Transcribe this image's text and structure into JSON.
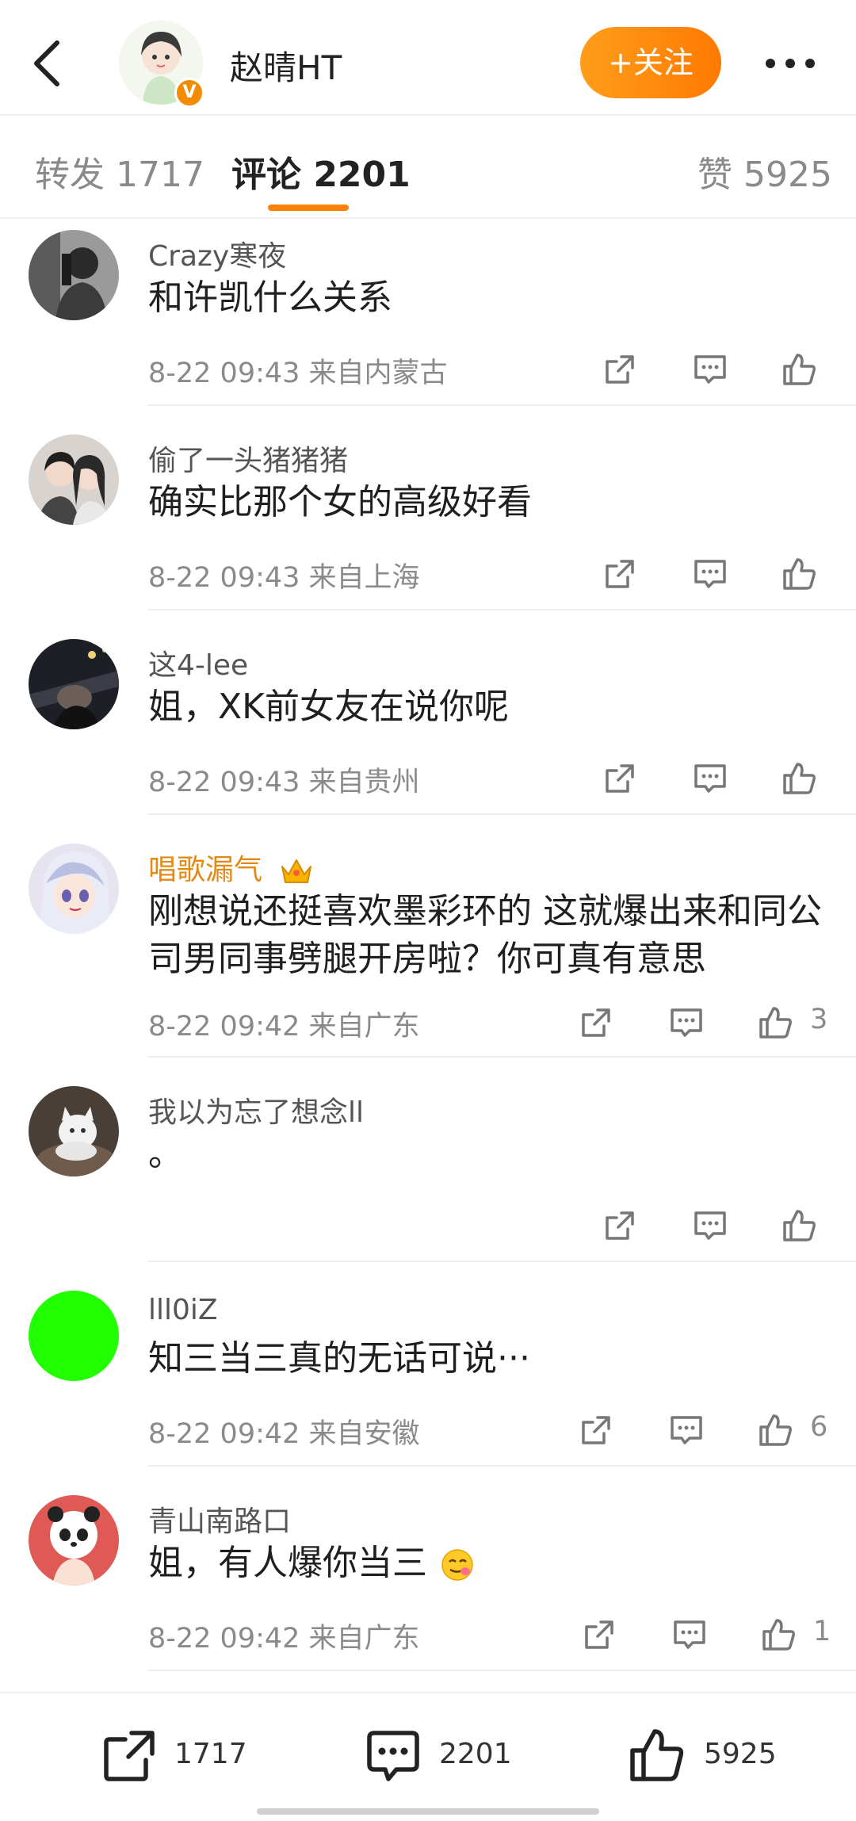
{
  "header": {
    "back_icon": "chevron-left-icon",
    "name": "赵晴HT",
    "verified_badge": "V",
    "follow_label": "+关注",
    "more_icon": "more-dots-icon",
    "accent_color": "#ff8200"
  },
  "tabs": [
    {
      "label": "转发 1717"
    },
    {
      "label": "评论 2201"
    },
    {
      "label": "赞 5925"
    }
  ],
  "comments": [
    {
      "user": "Crazy寒夜",
      "text": "和许凯什么关系",
      "meta": "8-22 09:43 来自内蒙古",
      "likes": ""
    },
    {
      "user": "偷了一头猪猪猪",
      "text": "确实比那个女的高级好看",
      "meta": "8-22 09:43 来自上海",
      "likes": ""
    },
    {
      "user": "这4-lee",
      "text": "姐，XK前女友在说你呢",
      "meta": "8-22 09:43 来自贵州",
      "likes": ""
    },
    {
      "user": "唱歌漏气",
      "text": "刚想说还挺喜欢墨彩环的 这就爆出来和同公司男同事劈腿开房啦？你可真有意思",
      "meta": "8-22 09:42 来自广东",
      "likes": "3"
    },
    {
      "user": "我以为忘了想念ll",
      "text": "。",
      "meta": "",
      "likes": ""
    },
    {
      "user": "lll0iZ",
      "text": "知三当三真的无话可说···",
      "meta": "8-22 09:42 来自安徽",
      "likes": "6"
    },
    {
      "user": "青山南路口",
      "text": "姐，有人爆你当三",
      "meta": "8-22 09:42 来自广东",
      "likes": "1"
    }
  ],
  "bottom_bar": {
    "repost_count": "1717",
    "comment_count": "2201",
    "like_count": "5925"
  }
}
